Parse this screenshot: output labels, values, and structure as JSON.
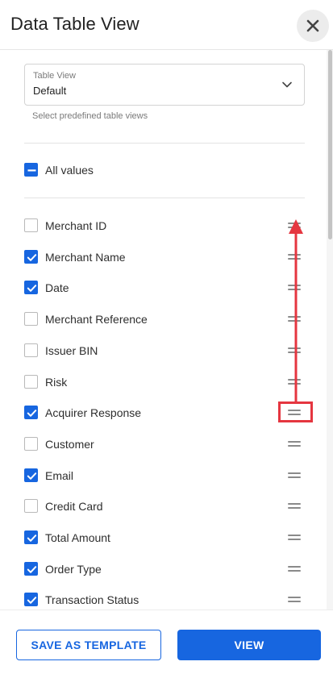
{
  "header": {
    "title": "Data Table View",
    "close_icon": "close-icon"
  },
  "table_view_select": {
    "label": "Table View",
    "value": "Default",
    "helper": "Select predefined table views",
    "icon": "chevron-down-icon"
  },
  "all_values": {
    "label": "All values",
    "state": "indeterminate"
  },
  "columns": [
    {
      "label": "Merchant ID",
      "checked": false
    },
    {
      "label": "Merchant Name",
      "checked": true
    },
    {
      "label": "Date",
      "checked": true
    },
    {
      "label": "Merchant Reference",
      "checked": false
    },
    {
      "label": "Issuer BIN",
      "checked": false
    },
    {
      "label": "Risk",
      "checked": false
    },
    {
      "label": "Acquirer Response",
      "checked": true
    },
    {
      "label": "Customer",
      "checked": false
    },
    {
      "label": "Email",
      "checked": true
    },
    {
      "label": "Credit Card",
      "checked": false
    },
    {
      "label": "Total Amount",
      "checked": true
    },
    {
      "label": "Order Type",
      "checked": true
    },
    {
      "label": "Transaction Status",
      "checked": true
    }
  ],
  "annotation": {
    "color": "#e53640",
    "highlighted_item": "Acquirer Response",
    "arrow_target_item": "Merchant ID"
  },
  "footer": {
    "save_template_label": "SAVE AS TEMPLATE",
    "view_label": "VIEW"
  },
  "colors": {
    "accent": "#1766e0",
    "annotation_red": "#e53640"
  }
}
